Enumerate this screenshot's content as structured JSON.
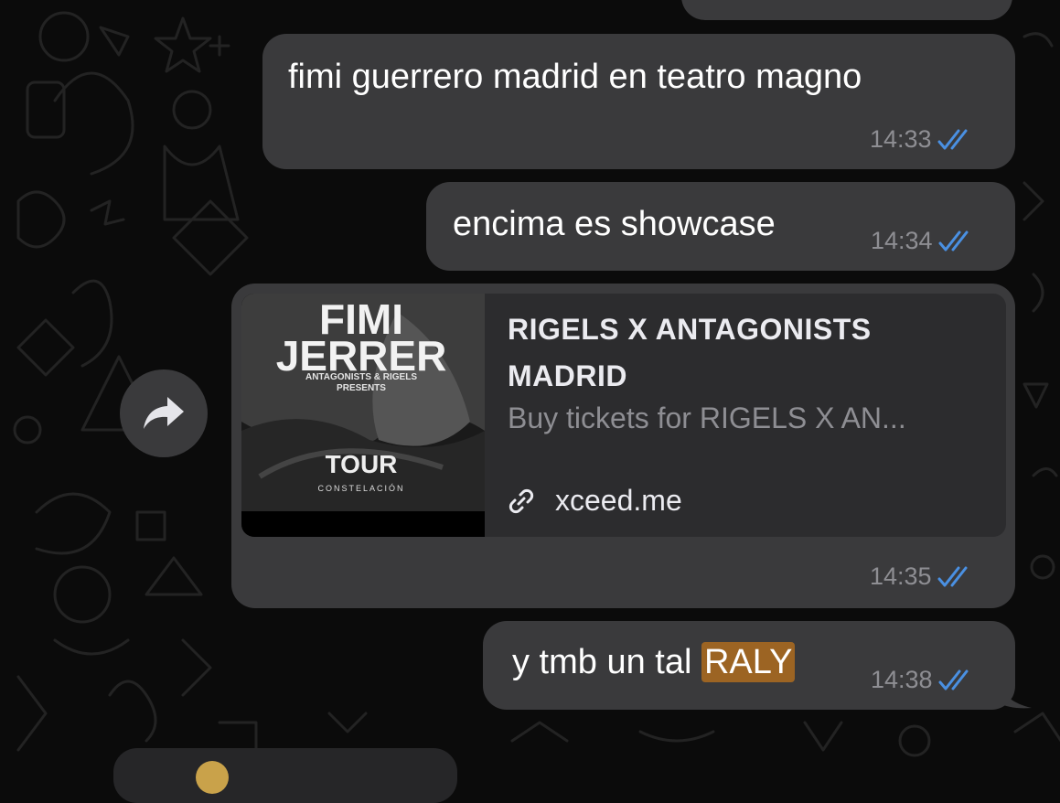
{
  "chat": {
    "messages": [
      {
        "text": "fimi guerrero madrid en teatro magno",
        "time": "14:33",
        "status_icon": "double-check-read-icon"
      },
      {
        "text": "encima es showcase",
        "time": "14:34",
        "status_icon": "double-check-read-icon"
      },
      {
        "link_preview": {
          "title_line1": "RIGELS X ANTAGONISTS",
          "title_line2": "MADRID",
          "description": "Buy tickets for RIGELS X AN...",
          "domain": "xceed.me",
          "thumbnail": {
            "headline1": "FIMI",
            "headline2": "JERRER",
            "presenters_line1": "ANTAGONISTS & RIGELS",
            "presenters_line2": "PRESENTS",
            "tour_label": "TOUR",
            "subtitle": "CONSTELACIÓN"
          }
        },
        "time": "14:35",
        "status_icon": "double-check-read-icon"
      },
      {
        "text_before": "y tmb un tal ",
        "highlighted": "RALY",
        "time": "14:38",
        "status_icon": "double-check-read-icon"
      }
    ]
  },
  "colors": {
    "background": "#0b0b0b",
    "bubble": "#3a3a3c",
    "link_card": "#2c2c2e",
    "highlight": "#9c6423",
    "read_ticks": "#4a90e2",
    "timestamp": "#8e8e93"
  }
}
